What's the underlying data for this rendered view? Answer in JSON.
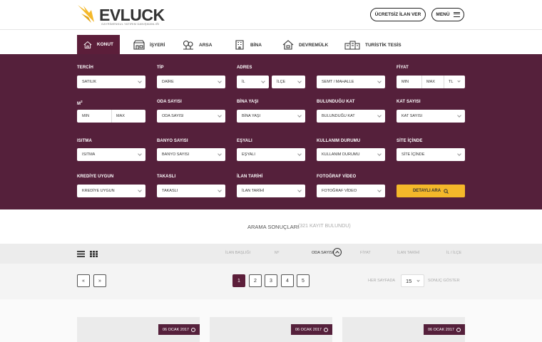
{
  "header": {
    "brand": "EVLUCK",
    "tagline": "GAYRİMENKUL YATIRIM DANIŞMANLIĞI",
    "post_ad": "ÜCRETSİZ İLAN VER",
    "menu": "MENÜ"
  },
  "tabs": [
    {
      "label": "KONUT",
      "icon": "house-icon"
    },
    {
      "label": "İŞYERİ",
      "icon": "shop-icon"
    },
    {
      "label": "ARSA",
      "icon": "land-icon"
    },
    {
      "label": "BİNA",
      "icon": "building-icon"
    },
    {
      "label": "DEVREMÜLK",
      "icon": "timeshare-icon"
    },
    {
      "label": "TURİSTİK TESİS",
      "icon": "hotel-icon"
    }
  ],
  "filters": {
    "tercih": {
      "label": "TERCİH",
      "value": "SATILIK"
    },
    "tip": {
      "label": "TİP",
      "value": "DAİRE"
    },
    "adres": {
      "label": "ADRES",
      "il": "İL",
      "ilce": "İLÇE",
      "semt": "SEMT / MAHALLE"
    },
    "fiyat": {
      "label": "FİYAT",
      "min": "MIN",
      "max": "MAX",
      "currency": "TL"
    },
    "m2": {
      "label": "M",
      "sup": "2",
      "min": "MIN",
      "max": "MAX"
    },
    "oda": {
      "label": "ODA SAYISI",
      "value": "ODA SAYISI"
    },
    "bina_yasi": {
      "label": "BİNA YAŞI",
      "value": "BİNA YAŞI"
    },
    "bulundugu_kat": {
      "label": "BULUNDUĞU KAT",
      "value": "BULUNDUĞU KAT"
    },
    "kat_sayisi": {
      "label": "KAT SAYISI",
      "value": "KAT SAYISI"
    },
    "isitma": {
      "label": "ISITMA",
      "value": "ISITMA"
    },
    "banyo": {
      "label": "BANYO SAYISI",
      "value": "BANYO SAYISI"
    },
    "esyali": {
      "label": "EŞYALI",
      "value": "EŞYALI"
    },
    "kullanim": {
      "label": "KULLANIM DURUMU",
      "value": "KULLANIM DURUMU"
    },
    "site": {
      "label": "SİTE İÇİNDE",
      "value": "SİTE İÇİNDE"
    },
    "kredi": {
      "label": "KREDİYE UYGUN",
      "value": "KREDİYE UYGUN"
    },
    "takas": {
      "label": "TAKASLI",
      "value": "TAKASLI"
    },
    "ilan_tarihi": {
      "label": "İLAN TARİHİ",
      "value": "İLAN TARİHİ"
    },
    "foto": {
      "label": "FOTOĞRAF VİDEO",
      "value": "FOTOĞRAF VİDEO"
    },
    "detailed_search": "DETAYLI ARA"
  },
  "results": {
    "title": "ARAMA SONUÇLARI",
    "count": "(321 KAYIT BULUNDU)"
  },
  "sort": {
    "items": [
      "İLAN BAŞLIĞI",
      "M²",
      "ODA SAYISI",
      "FİYAT",
      "İLAN TARİHİ",
      "İL / İLÇE"
    ]
  },
  "pager": {
    "prev": "«",
    "next": "»",
    "pages": [
      "1",
      "2",
      "3",
      "4",
      "5"
    ],
    "per_page_label": "HER SAYFADA",
    "per_page_value": "15",
    "show_label": "SONUÇ GÖSTER"
  },
  "cards": [
    {
      "date": "06 OCAK 2017"
    },
    {
      "date": "06 OCAK 2017"
    },
    {
      "date": "06 OCAK 2017"
    }
  ],
  "colors": {
    "primary": "#55203b",
    "accent": "#f4b82a"
  }
}
